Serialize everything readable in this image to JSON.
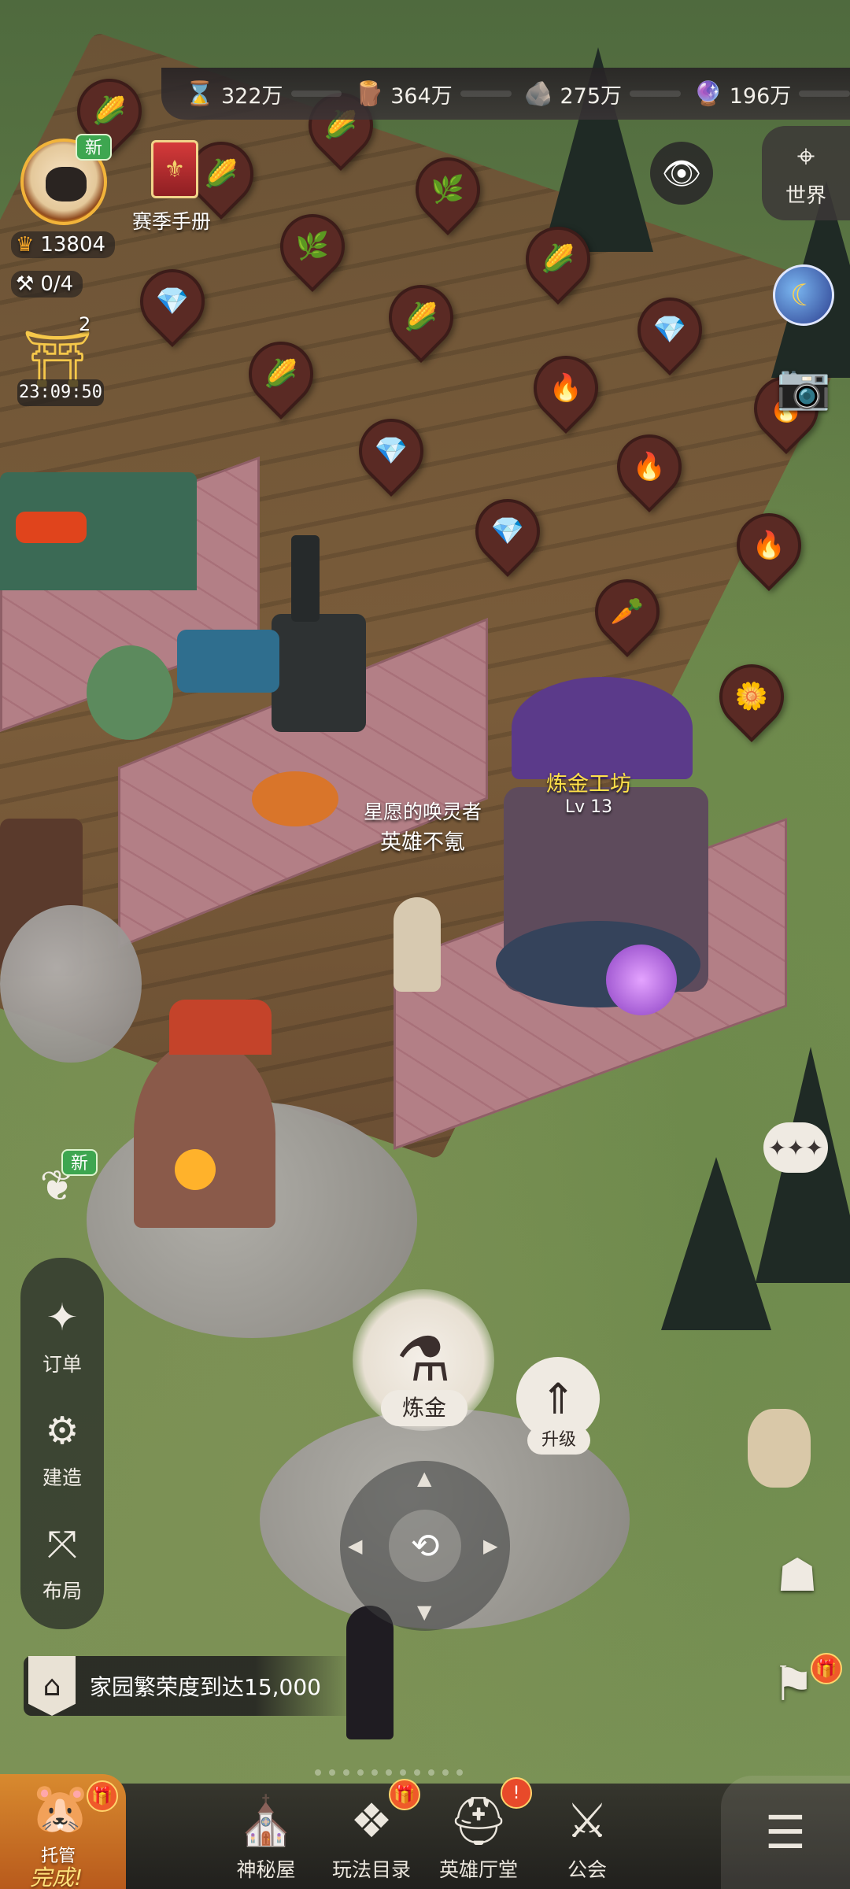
{
  "resources": [
    {
      "icon": "hourglass-icon",
      "value": "322万"
    },
    {
      "icon": "wood-log-icon",
      "value": "364万"
    },
    {
      "icon": "stone-ore-icon",
      "value": "275万"
    },
    {
      "icon": "crystal-orb-icon",
      "value": "196万"
    }
  ],
  "player": {
    "new_badge": "新",
    "power": "13804",
    "hammer_count": "0/4"
  },
  "season": {
    "label": "赛季手册"
  },
  "event": {
    "count": "2",
    "timer": "23:09:50"
  },
  "world_button": {
    "label": "世界"
  },
  "buildings": {
    "alchemy": {
      "name": "炼金工坊",
      "level": "Lv 13"
    }
  },
  "npc": {
    "line1": "星愿的唤灵者",
    "line2": "英雄不氪"
  },
  "left_menu": {
    "new_badge": "新",
    "items": [
      {
        "label": "订单"
      },
      {
        "label": "建造"
      },
      {
        "label": "布局"
      }
    ]
  },
  "actions": {
    "alchemy": "炼金",
    "upgrade": "升级"
  },
  "quest": {
    "text": "家园繁荣度到达15,000"
  },
  "host": {
    "line1": "托管",
    "line2": "完成!"
  },
  "bottom_nav": [
    {
      "label": "神秘屋"
    },
    {
      "label": "玩法目录"
    },
    {
      "label": "英雄厅堂"
    },
    {
      "label": "公会"
    }
  ]
}
